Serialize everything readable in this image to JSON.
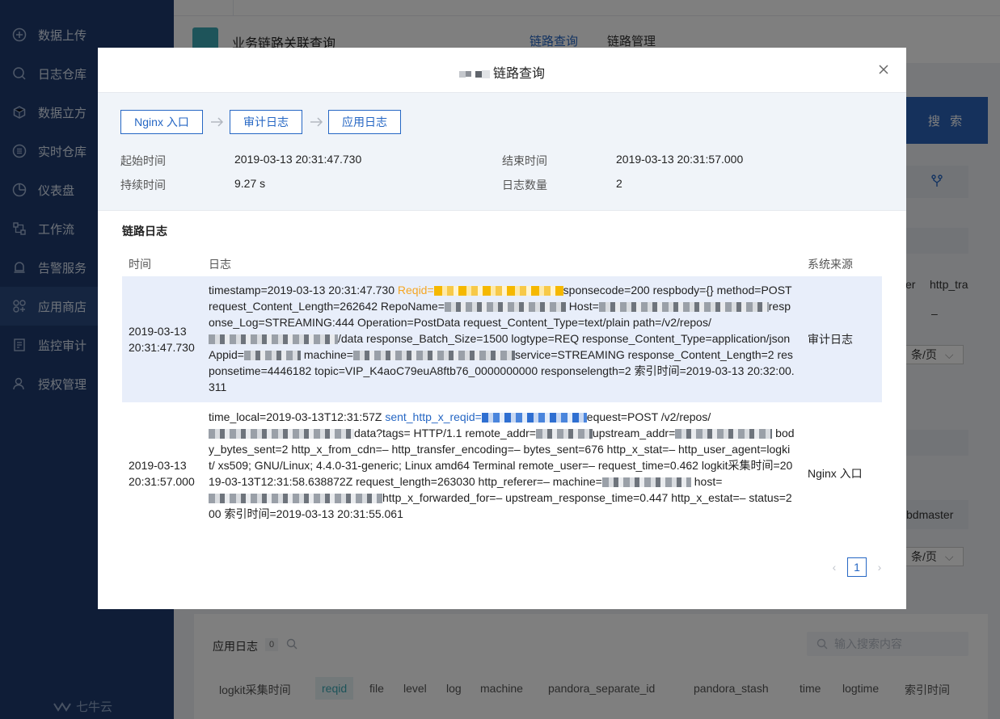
{
  "sidebar": {
    "items": [
      {
        "label": "数据上传",
        "icon": "upload-icon"
      },
      {
        "label": "日志仓库",
        "icon": "log-search-icon"
      },
      {
        "label": "数据立方",
        "icon": "cube-icon"
      },
      {
        "label": "实时仓库",
        "icon": "list-icon"
      },
      {
        "label": "仪表盘",
        "icon": "dashboard-icon"
      },
      {
        "label": "工作流",
        "icon": "workflow-icon"
      },
      {
        "label": "告警服务",
        "icon": "alarm-icon"
      },
      {
        "label": "应用商店",
        "icon": "app-store-icon"
      },
      {
        "label": "监控审计",
        "icon": "audit-icon"
      },
      {
        "label": "授权管理",
        "icon": "user-auth-icon"
      }
    ],
    "logo": "七牛云"
  },
  "header": {
    "title": "业务链路关联查询",
    "tabs": [
      "链路查询",
      "链路管理"
    ]
  },
  "background": {
    "search_button": "搜 索",
    "text_er": "er",
    "text_http": "http_tra",
    "text_dash": "–",
    "per_page_1": "条/页",
    "text_bdmaster": "bdmaster",
    "per_page_2": "条/页",
    "app_log_title": "应用日志",
    "app_log_count": "0",
    "search_placeholder": "输入搜索内容",
    "columns": [
      "logkit采集时间",
      "reqid",
      "file",
      "level",
      "log",
      "machine",
      "pandora_separate_id",
      "pandora_stash",
      "time",
      "logtime",
      "索引时间"
    ]
  },
  "modal": {
    "title": "链路查询",
    "steps": [
      "Nginx 入口",
      "审计日志",
      "应用日志"
    ],
    "info": {
      "start_label": "起始时间",
      "start_value": "2019-03-13 20:31:47.730",
      "end_label": "结束时间",
      "end_value": "2019-03-13 20:31:57.000",
      "duration_label": "持续时间",
      "duration_value": "9.27 s",
      "count_label": "日志数量",
      "count_value": "2"
    },
    "section_title": "链路日志",
    "columns": {
      "time": "时间",
      "log": "日志",
      "source": "系统来源"
    },
    "rows": [
      {
        "time_line1": "2019-03-13",
        "time_line2": "20:31:47.730",
        "log": {
          "p1": "timestamp=2019-03-13 20:31:47.730 ",
          "reqid": "Reqid=",
          "p2": "sponsecode=200 respbody={} method=POST request_Content_Length=262642 RepoName=",
          "p3": " Host=",
          "p4": "response_Log=STREAMING:444 Operation=PostData request_Content_Type=text/plain path=/v2/repos/",
          "p5": "/data response_Batch_Size=1500 logtype=REQ response_Content_Type=application/json Appid=",
          "p6": " machine=",
          "p7": "service=STREAMING response_Content_Length=2 responsetime=4446182 topic=VIP_K4aoC79euA8ftb76_0000000000 responselength=2 索引时间=2019-03-13 20:32:00.311"
        },
        "source": "审计日志"
      },
      {
        "time_line1": "2019-03-13",
        "time_line2": "20:31:57.000",
        "log": {
          "p1": "time_local=2019-03-13T12:31:57Z ",
          "reqid": "sent_http_x_reqid=",
          "p2": "equest=POST /v2/repos/",
          "p3": "data?tags= HTTP/1.1 remote_addr=",
          "p4": "upstream_addr=",
          "p5": " body_bytes_sent=2 http_x_from_cdn=– http_transfer_encoding=– bytes_sent=676 http_x_stat=– http_user_agent=logkit/ xs509; GNU/Linux; 4.4.0-31-generic; Linux amd64 Terminal remote_user=– request_time=0.462 logkit采集时间=2019-03-13T12:31:58.638872Z request_length=263030 http_referer=– machine=",
          "p6": " host=",
          "p7": "http_x_forwarded_for=– upstream_response_time=0.447 http_x_estat=– status=200 索引时间=2019-03-13 20:31:55.061"
        },
        "source": "Nginx 入口"
      }
    ],
    "pagination": {
      "current": "1"
    }
  }
}
